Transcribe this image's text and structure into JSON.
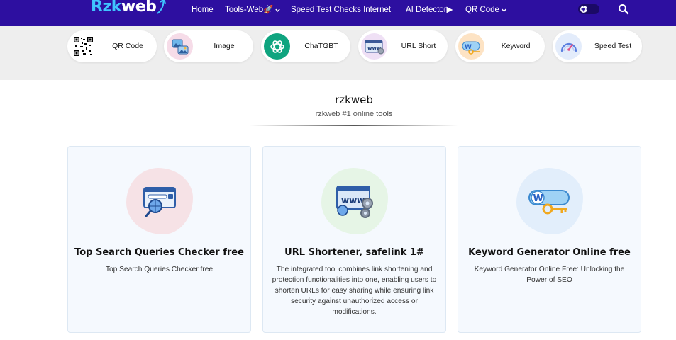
{
  "brand": {
    "part1": "Rzk",
    "part2": "web"
  },
  "nav": {
    "items": [
      {
        "label": "Home",
        "dropdown": false
      },
      {
        "label": "Tools-Web🚀",
        "dropdown": true
      },
      {
        "label": "Speed Test Checks Internet",
        "dropdown": false
      },
      {
        "label": "AI Detector▶",
        "dropdown": false
      },
      {
        "label": "QR Code",
        "dropdown": true
      }
    ],
    "theme_toggle_icon": "sun-icon",
    "search_icon": "search-icon"
  },
  "tools": [
    {
      "label": "QR Code",
      "icon": "qr-code-icon"
    },
    {
      "label": "Image",
      "icon": "image-icon"
    },
    {
      "label": "ChaTGBT",
      "icon": "chatgpt-icon"
    },
    {
      "label": "URL Short",
      "icon": "url-icon"
    },
    {
      "label": "Keyword",
      "icon": "keyword-icon"
    },
    {
      "label": "Speed Test",
      "icon": "speedometer-icon"
    }
  ],
  "heading": {
    "title": "rzkweb",
    "subtitle": "rzkweb #1 online tools"
  },
  "cards": [
    {
      "title": "Top Search Queries Checker free",
      "description": "Top Search Queries Checker free",
      "icon": "search-queries-icon"
    },
    {
      "title": "URL Shortener, safelink 1#",
      "description": "The integrated tool combines link shortening and protection functionalities into one, enabling users to shorten URLs for easy sharing while ensuring link security against unauthorized access or modifications.",
      "icon": "www-gear-icon"
    },
    {
      "title": "Keyword Generator Online free",
      "description": "Keyword Generator Online Free: Unlocking the Power of SEO",
      "icon": "keyword-key-icon"
    }
  ],
  "colors": {
    "nav_bg": "#2d0fa0",
    "logo_accent": "#3fc4ff",
    "strip_bg": "#eeeeee",
    "card_bg": "#f5f9fe"
  }
}
